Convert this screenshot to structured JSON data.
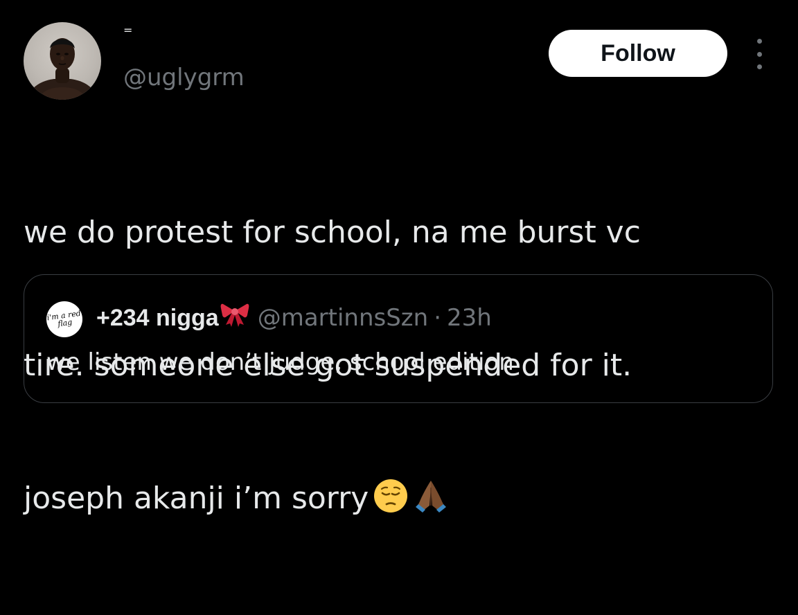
{
  "author": {
    "display_name": "=",
    "handle": "@uglygrm",
    "avatar_icon": "profile-photo"
  },
  "follow_button": {
    "label": "Follow"
  },
  "more_icon": "more-options-icon",
  "tweet": {
    "lines": [
      "we do protest for school, na me burst vc",
      "tire. someone else got suspended for it.",
      "joseph akanji i’m sorry"
    ],
    "emojis": [
      "pensive-face-emoji",
      "folded-hands-emoji"
    ]
  },
  "quoted_tweet": {
    "avatar_text": "i'm a red flag",
    "display_name": "+234 nigga",
    "name_emoji": "ribbon-emoji",
    "handle": "@martinnsSzn",
    "separator": "·",
    "time": "23h",
    "text": "we listen we don’t judge, school edition"
  },
  "colors": {
    "background": "#000000",
    "text_primary": "#e7e9ea",
    "text_secondary": "#71767b",
    "follow_bg": "#ffffff",
    "follow_text": "#0f1419",
    "border": "#3a3e43"
  }
}
